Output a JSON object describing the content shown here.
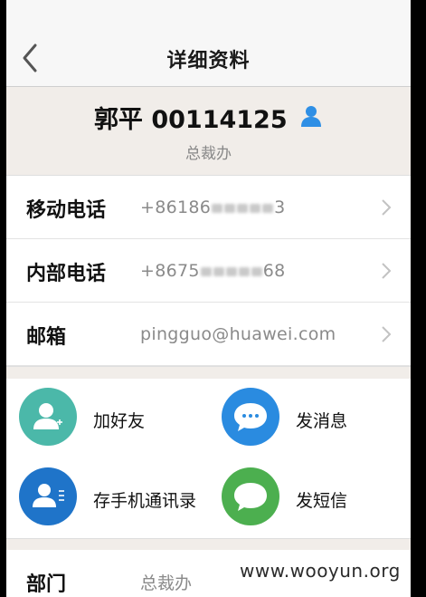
{
  "nav": {
    "title": "详细资料"
  },
  "profile": {
    "name": "郭平 00114125",
    "department": "总裁办"
  },
  "info": {
    "mobile": {
      "label": "移动电话",
      "value_prefix": "+86186",
      "value_suffix": "3"
    },
    "internal": {
      "label": "内部电话",
      "value_prefix": "+8675",
      "value_suffix": "68"
    },
    "email": {
      "label": "邮箱",
      "value": "pingguo@huawei.com"
    }
  },
  "actions": {
    "add_friend": "加好友",
    "send_message": "发消息",
    "save_contacts": "存手机通讯录",
    "send_sms": "发短信"
  },
  "dept": {
    "label": "部门",
    "value": "总裁办"
  },
  "watermark": "www.wooyun.org",
  "colors": {
    "teal": "#4bb8a9",
    "blue": "#2a8be0",
    "darkblue": "#1f74c9",
    "green": "#4caf4f",
    "person_icon": "#2f8fe5"
  },
  "icons": {
    "back": "chevron-left-icon",
    "person": "person-icon",
    "chevron": "chevron-right-icon",
    "add_friend": "add-person-icon",
    "message": "chat-bubble-icon",
    "contacts": "contact-card-icon",
    "sms": "sms-bubble-icon"
  }
}
